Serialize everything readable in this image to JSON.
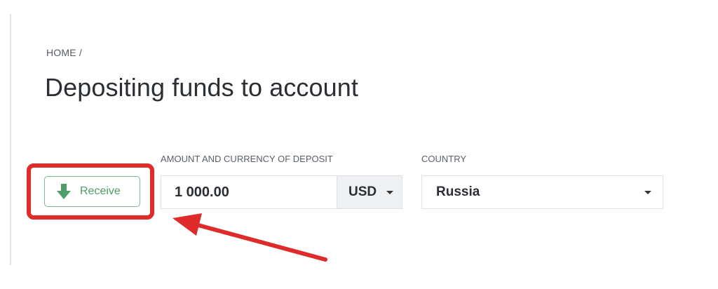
{
  "breadcrumb": {
    "text": "HOME /"
  },
  "page": {
    "title": "Depositing funds to account"
  },
  "form": {
    "receive_button": {
      "label": "Receive",
      "icon": "arrow-down-icon"
    },
    "amount": {
      "label": "AMOUNT AND CURRENCY OF DEPOSIT",
      "value": "1 000.00"
    },
    "currency": {
      "selected": "USD"
    },
    "country": {
      "label": "COUNTRY",
      "selected": "Russia"
    }
  },
  "annotation": {
    "color": "#e02b2b"
  },
  "colors": {
    "receive_green": "#4c9e6a",
    "receive_border": "#7db994"
  }
}
